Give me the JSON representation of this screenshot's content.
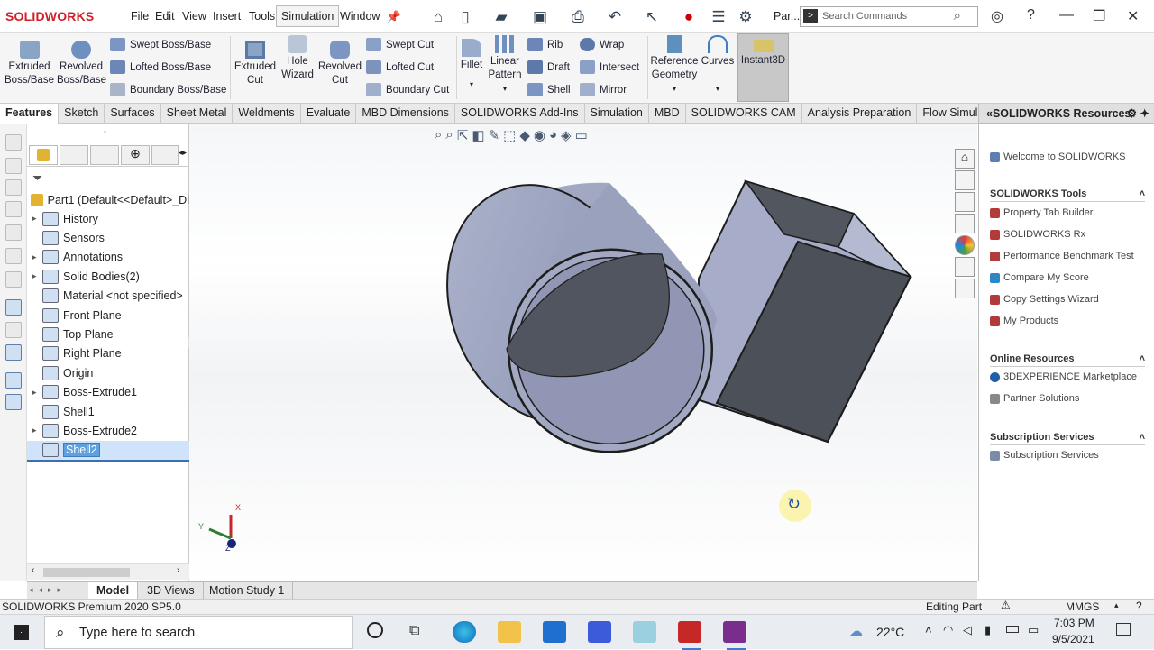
{
  "app": {
    "logo": "SOLIDWORKS",
    "menus": [
      "File",
      "Edit",
      "View",
      "Insert",
      "Tools",
      "Simulation",
      "Window"
    ],
    "active_menu": "Simulation",
    "doc_short": "Par...",
    "search_placeholder": "Search Commands"
  },
  "ribbon": {
    "extruded_boss": "Extruded Boss/Base",
    "revolved_boss": "Revolved Boss/Base",
    "swept_boss": "Swept Boss/Base",
    "lofted_boss": "Lofted Boss/Base",
    "boundary_boss": "Boundary Boss/Base",
    "extruded_cut": "Extruded Cut",
    "hole_wizard": "Hole Wizard",
    "revolved_cut": "Revolved Cut",
    "swept_cut": "Swept Cut",
    "lofted_cut": "Lofted Cut",
    "boundary_cut": "Boundary Cut",
    "fillet": "Fillet",
    "linear_pattern": "Linear Pattern",
    "rib": "Rib",
    "draft": "Draft",
    "shell": "Shell",
    "wrap": "Wrap",
    "intersect": "Intersect",
    "mirror": "Mirror",
    "reference_geometry": "Reference Geometry",
    "curves": "Curves",
    "instant3d": "Instant3D"
  },
  "command_tabs": [
    "Features",
    "Sketch",
    "Surfaces",
    "Sheet Metal",
    "Weldments",
    "Evaluate",
    "MBD Dimensions",
    "SOLIDWORKS Add-Ins",
    "Simulation",
    "MBD",
    "SOLIDWORKS CAM",
    "Analysis Preparation",
    "Flow Simulation"
  ],
  "feature_tree": {
    "root": "Part1  (Default<<Default>_Di",
    "items": [
      {
        "label": "History",
        "expandable": true
      },
      {
        "label": "Sensors",
        "expandable": false
      },
      {
        "label": "Annotations",
        "expandable": true
      },
      {
        "label": "Solid Bodies(2)",
        "expandable": true
      },
      {
        "label": "Material <not specified>",
        "expandable": false
      },
      {
        "label": "Front Plane",
        "expandable": false
      },
      {
        "label": "Top Plane",
        "expandable": false
      },
      {
        "label": "Right Plane",
        "expandable": false
      },
      {
        "label": "Origin",
        "expandable": false
      },
      {
        "label": "Boss-Extrude1",
        "expandable": true
      },
      {
        "label": "Shell1",
        "expandable": false
      },
      {
        "label": "Boss-Extrude2",
        "expandable": true
      },
      {
        "label": "Shell2",
        "expandable": false
      }
    ],
    "selected": "Shell2"
  },
  "task_pane": {
    "title": "SOLIDWORKS Resources",
    "welcome": "Welcome to SOLIDWORKS",
    "tools_header": "SOLIDWORKS Tools",
    "tools": [
      "Property Tab Builder",
      "SOLIDWORKS Rx",
      "Performance Benchmark Test",
      "Compare My Score",
      "Copy Settings Wizard",
      "My Products"
    ],
    "online_header": "Online Resources",
    "online": [
      "3DEXPERIENCE Marketplace",
      "Partner Solutions"
    ],
    "subscription_header": "Subscription Services",
    "subscription": [
      "Subscription Services"
    ]
  },
  "bottom_tabs": [
    "Model",
    "3D Views",
    "Motion Study 1"
  ],
  "status": {
    "product": "SOLIDWORKS Premium 2020 SP5.0",
    "mode": "Editing Part",
    "units": "MMGS"
  },
  "taskbar": {
    "search": "Type here to search",
    "temperature": "22°C",
    "time": "7:03 PM",
    "date": "9/5/2021"
  },
  "triad": {
    "x": "X",
    "y": "Y",
    "z": "Z"
  },
  "colors": {
    "brand": "#d0202a",
    "selection": "#5fa0dd",
    "body": "#9aa3bf"
  }
}
